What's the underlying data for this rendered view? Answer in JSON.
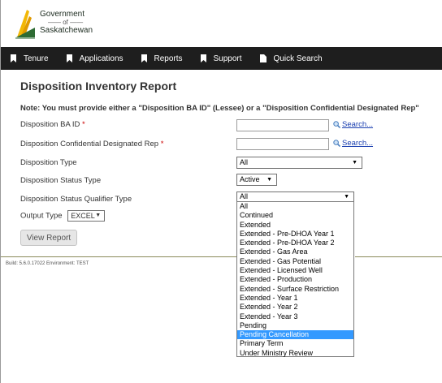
{
  "logo": {
    "line1": "Government",
    "line2": "of",
    "line3": "Saskatchewan"
  },
  "nav": [
    {
      "label": "Tenure",
      "icon": "bookmark-icon"
    },
    {
      "label": "Applications",
      "icon": "bookmark-icon"
    },
    {
      "label": "Reports",
      "icon": "bookmark-icon"
    },
    {
      "label": "Support",
      "icon": "bookmark-icon"
    },
    {
      "label": "Quick Search",
      "icon": "document-icon"
    }
  ],
  "page": {
    "title": "Disposition Inventory Report",
    "note": "Note: You must provide either a \"Disposition BA ID\" (Lessee) or a \"Disposition Confidential Designated Rep\""
  },
  "form": {
    "ba_id_label": "Disposition BA ID",
    "conf_rep_label": "Disposition Confidential Designated Rep",
    "required_mark": "*",
    "search_label": "Search...",
    "type_label": "Disposition Type",
    "type_value": "All",
    "status_label": "Disposition Status Type",
    "status_value": "Active",
    "qualifier_label": "Disposition Status Qualifier Type",
    "qualifier_value": "All",
    "output_label": "Output Type",
    "output_value": "EXCEL",
    "view_button": "View Report",
    "arrow": "▼"
  },
  "qualifier_options": [
    "All",
    "Continued",
    "Extended",
    "Extended - Pre-DHOA Year 1",
    "Extended - Pre-DHOA Year 2",
    "Extended - Gas Area",
    "Extended - Gas Potential",
    "Extended - Licensed Well",
    "Extended - Production",
    "Extended - Surface Restriction",
    "Extended - Year 1",
    "Extended - Year 2",
    "Extended - Year 3",
    "Pending",
    "Pending Cancellation",
    "Primary Term",
    "Under Ministry Review"
  ],
  "highlighted_option": "Pending Cancellation",
  "footer": {
    "build": "Build: 5.6.0.17022 Environment: TEST"
  },
  "colors": {
    "nav_bg": "#1e1e1e",
    "link": "#1a3fb0",
    "required": "#cc0000",
    "highlight": "#3399ff"
  }
}
